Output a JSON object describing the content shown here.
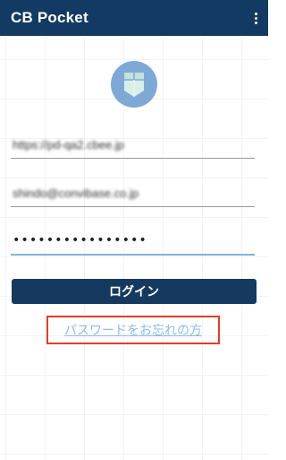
{
  "appbar": {
    "title": "CB Pocket",
    "menu_icon": "more-vert-icon"
  },
  "form": {
    "url_value": "https://pd-qa2.cbee.jp",
    "email_value": "shindo@convibase.co.jp",
    "password_value": "••••••••••••••••",
    "login_label": "ログイン",
    "forgot_password_label": "パスワードをお忘れの方"
  },
  "colors": {
    "header": "#123a63",
    "button": "#163a5f",
    "link": "#8cbbe3",
    "highlight_border": "#e43b2a",
    "logo_circle": "#7ea9d7"
  }
}
